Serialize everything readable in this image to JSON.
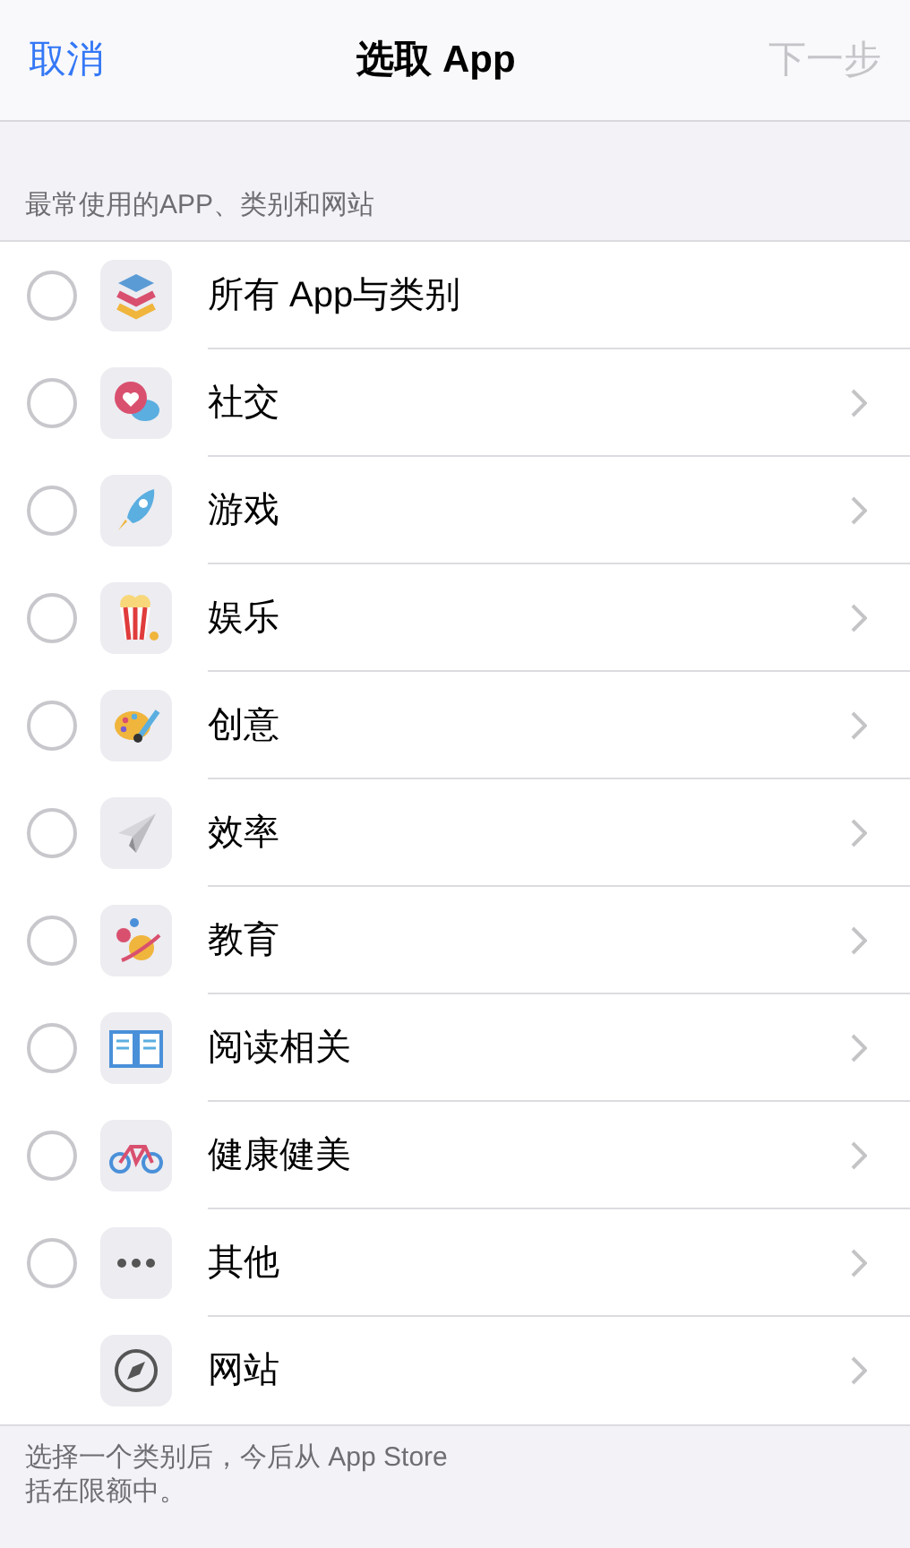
{
  "nav": {
    "cancel": "取消",
    "title": "选取 App",
    "next": "下一步",
    "next_disabled": true
  },
  "section_header": "最常使用的APP、类别和网站",
  "rows": [
    {
      "label": "所有 App与类别",
      "kind": "radio",
      "selected": false,
      "chevron": false
    },
    {
      "label": "社交",
      "kind": "radio",
      "selected": false,
      "chevron": true
    },
    {
      "label": "游戏",
      "kind": "radio",
      "selected": false,
      "chevron": true
    },
    {
      "label": "娱乐",
      "kind": "radio",
      "selected": false,
      "chevron": true
    },
    {
      "label": "创意",
      "kind": "radio",
      "selected": false,
      "chevron": true
    },
    {
      "label": "效率",
      "kind": "radio",
      "selected": false,
      "chevron": true
    },
    {
      "label": "教育",
      "kind": "radio",
      "selected": false,
      "chevron": true
    },
    {
      "label": "阅读相关",
      "kind": "radio",
      "selected": false,
      "chevron": true
    },
    {
      "label": "健康健美",
      "kind": "radio",
      "selected": false,
      "chevron": true
    },
    {
      "label": "其他",
      "kind": "radio",
      "selected": false,
      "chevron": true
    },
    {
      "label": "网站",
      "kind": "plain",
      "chevron": true
    }
  ],
  "footer": [
    "选择一个类别后，今后从 App Store",
    "括在限额中。"
  ]
}
